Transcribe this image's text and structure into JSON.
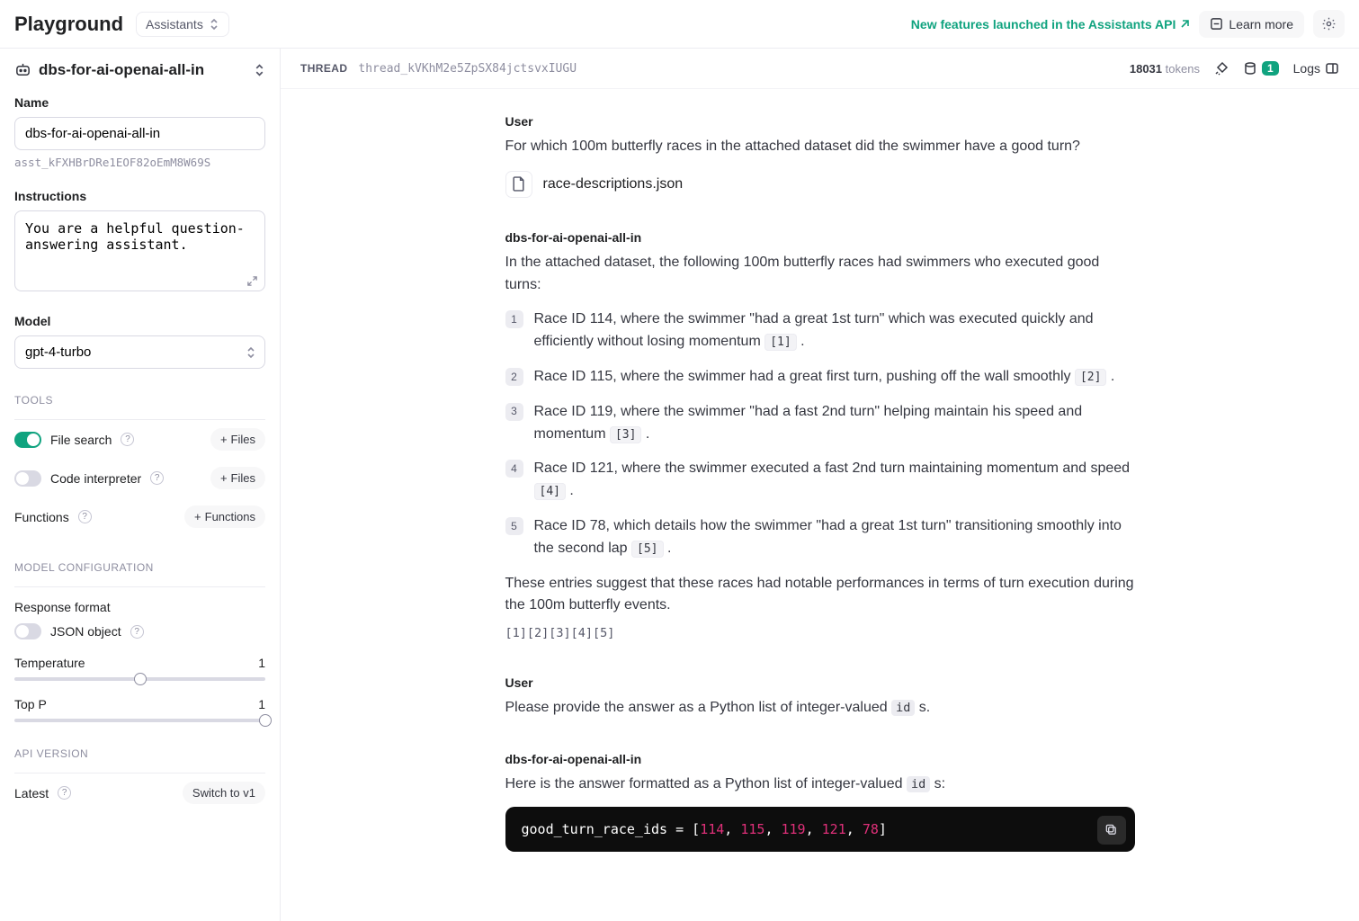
{
  "header": {
    "logo": "Playground",
    "mode": "Assistants",
    "newFeatures": "New features launched in the Assistants API",
    "learnMore": "Learn more"
  },
  "sidebar": {
    "assistantName": "dbs-for-ai-openai-all-in",
    "nameLabel": "Name",
    "nameValue": "dbs-for-ai-openai-all-in",
    "assistantId": "asst_kFXHBrDRe1EOF82oEmM8W69S",
    "instructionsLabel": "Instructions",
    "instructionsValue": "You are a helpful question-answering assistant.",
    "modelLabel": "Model",
    "modelValue": "gpt-4-turbo",
    "toolsLabel": "TOOLS",
    "fileSearch": "File search",
    "codeInterpreter": "Code interpreter",
    "functions": "Functions",
    "filesBtn": "Files",
    "functionsBtn": "Functions",
    "modelConfigLabel": "MODEL CONFIGURATION",
    "responseFormat": "Response format",
    "jsonObject": "JSON object",
    "temperature": "Temperature",
    "temperatureValue": "1",
    "topP": "Top P",
    "topPValue": "1",
    "apiVersion": "API VERSION",
    "latest": "Latest",
    "switchTo": "Switch to v1"
  },
  "threadBar": {
    "threadLabel": "THREAD",
    "threadId": "thread_kVKhM2e5ZpSX84jctsvxIUGU",
    "tokensCount": "18031",
    "tokensLabel": "tokens",
    "fileCount": "1",
    "logs": "Logs"
  },
  "conv": {
    "user1": {
      "role": "User",
      "text": "For which 100m butterfly races in the attached dataset did the swimmer have a good turn?",
      "file": "race-descriptions.json"
    },
    "asst1": {
      "role": "dbs-for-ai-openai-all-in",
      "intro": "In the attached dataset, the following 100m butterfly races had swimmers who executed good turns:",
      "items": [
        {
          "text_a": "Race ID 114, where the swimmer \"had a great 1st turn\" which was executed quickly and efficiently without losing momentum ",
          "ref": "[1]",
          "text_b": " ."
        },
        {
          "text_a": "Race ID 115, where the swimmer had a great first turn, pushing off the wall smoothly ",
          "ref": "[2]",
          "text_b": " ."
        },
        {
          "text_a": "Race ID 119, where the swimmer \"had a fast 2nd turn\" helping maintain his speed and momentum ",
          "ref": "[3]",
          "text_b": " ."
        },
        {
          "text_a": "Race ID 121, where the swimmer executed a fast 2nd turn maintaining momentum and speed ",
          "ref": "[4]",
          "text_b": " ."
        },
        {
          "text_a": "Race ID 78, which details how the swimmer \"had a great 1st turn\" transitioning smoothly into the second lap ",
          "ref": "[5]",
          "text_b": " ."
        }
      ],
      "outro": "These entries suggest that these races had notable performances in terms of turn execution during the 100m butterfly events.",
      "refsLine": "[1][2][3][4][5]"
    },
    "user2": {
      "role": "User",
      "pre": "Please provide the answer as a Python list of integer-valued ",
      "code": "id",
      "post": " s."
    },
    "asst2": {
      "role": "dbs-for-ai-openai-all-in",
      "pre": "Here is the answer formatted as a Python list of integer-valued ",
      "code": "id",
      "post": " s:",
      "codeBlock": {
        "var": "good_turn_race_ids = [",
        "nums": [
          "114",
          "115",
          "119",
          "121",
          "78"
        ],
        "sep": ", ",
        "close": "]"
      }
    }
  }
}
